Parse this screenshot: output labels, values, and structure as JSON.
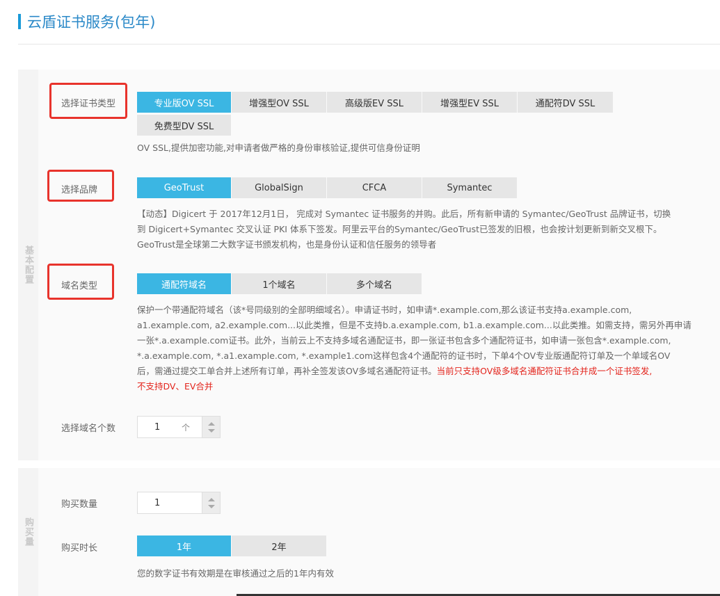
{
  "page": {
    "title": "云盾证书服务(包年)"
  },
  "basic": {
    "section_label": "基本配置",
    "cert_type": {
      "label": "选择证书类型",
      "options": [
        "专业版OV SSL",
        "增强型OV SSL",
        "高级版EV SSL",
        "增强型EV SSL",
        "通配符DV SSL",
        "免费型DV SSL"
      ],
      "selected": "专业版OV SSL",
      "description": "OV SSL,提供加密功能,对申请者做严格的身份审核验证,提供可信身份证明"
    },
    "brand": {
      "label": "选择品牌",
      "options": [
        "GeoTrust",
        "GlobalSign",
        "CFCA",
        "Symantec"
      ],
      "selected": "GeoTrust",
      "description": [
        "【动态】Digicert 于 2017年12月1日， 完成对 Symantec 证书服务的并购。此后，所有新申请的 Symantec/GeoTrust 品牌证书，切换",
        "到 Digicert+Symantec 交叉认证 PKI 体系下签发。阿里云平台的Symantec/GeoTrust已签发的旧根，也会按计划更新到新交叉根下。",
        "GeoTrust是全球第二大数字证书颁发机构，也是身份认证和信任服务的领导者"
      ]
    },
    "domain_type": {
      "label": "域名类型",
      "options": [
        "通配符域名",
        "1个域名",
        "多个域名"
      ],
      "selected": "通配符域名",
      "description": [
        "保护一个带通配符域名（该*号同级别的全部明细域名）。申请证书时，如申请*.example.com,那么该证书支持a.example.com,",
        "a1.example.com, a2.example.com...以此类推，但是不支持b.a.example.com, b1.a.example.com...以此类推。如需支持，需另外再申请",
        "一张*.a.example.com证书。此外，当前云上不支持多域名通配证书，即一张证书包含多个通配符证书，如申请一张包含*.example.com,",
        "*.a.example.com, *.a1.example.com, *.example1.com这样包含4个通配符的证书时，下单4个OV专业版通配符订单及一个单域名OV",
        "后，需通过提交工单合并上述所有订单，再补全签发该OV多域名通配符证书。"
      ],
      "warning_part1": "当前只支持OV级多域名通配符证书合并成一个证书签发,",
      "warning_part2": "不支持DV、EV合并"
    },
    "domain_count": {
      "label": "选择域名个数",
      "value": "1",
      "unit": "个"
    }
  },
  "purchase": {
    "section_label": "购买量",
    "quantity": {
      "label": "购买数量",
      "value": "1"
    },
    "duration": {
      "label": "购买时长",
      "options": [
        "1年",
        "2年"
      ],
      "selected": "1年",
      "description": "您的数字证书有效期是在审核通过之后的1年内有效"
    }
  },
  "colors": {
    "accent": "#3bb6e3",
    "title": "#2b89c8",
    "highlight_box": "#e8332c",
    "warning": "#e3241c"
  }
}
